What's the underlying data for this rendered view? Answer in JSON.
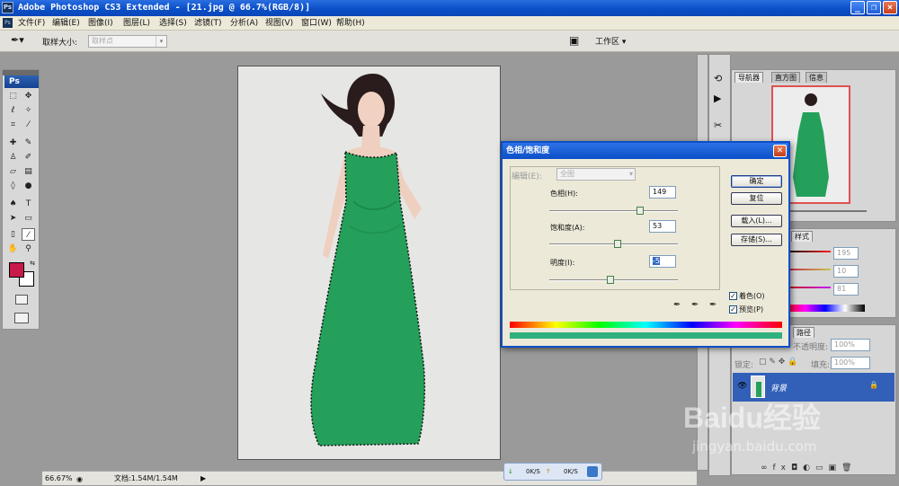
{
  "window": {
    "title": "Adobe Photoshop CS3 Extended - [21.jpg @ 66.7%(RGB/8)]"
  },
  "menu": [
    "文件(F)",
    "编辑(E)",
    "图像(I)",
    "图层(L)",
    "选择(S)",
    "滤镜(T)",
    "分析(A)",
    "视图(V)",
    "窗口(W)",
    "帮助(H)"
  ],
  "options": {
    "sample_size_label": "取样大小:",
    "sample_value": "取样点",
    "workspace": "工作区 ▾"
  },
  "toolbox": {
    "badge": "Ps"
  },
  "status": {
    "zoom": "66.67%",
    "doc": "文档:1.54M/1.54M"
  },
  "network": {
    "down": "0K/S",
    "up": "0K/S"
  },
  "navigator": {
    "tabs": [
      "导航器",
      "直方图",
      "信息"
    ]
  },
  "color_panel": {
    "tab": "样式",
    "values": [
      "195",
      "10",
      "81"
    ]
  },
  "layers": {
    "tab": "路径",
    "opacity_label": "不透明度:",
    "opacity": "100%",
    "lock_label": "锁定:",
    "fill_label": "填充:",
    "fill": "100%",
    "layer_name": "背景"
  },
  "dialog": {
    "title": "色相/饱和度",
    "edit_label": "编辑(E):",
    "edit_value": "全图",
    "hue_label": "色相(H):",
    "hue": "149",
    "hue_frac": 0.707,
    "sat_label": "饱和度(A):",
    "sat": "53",
    "sat_frac": 0.53,
    "light_label": "明度(I):",
    "light": "-5",
    "light_frac": 0.475,
    "ok": "确定",
    "cancel": "复位",
    "load": "载入(L)...",
    "save": "存储(S)...",
    "colorize": "着色(O)",
    "preview": "预览(P)"
  },
  "watermark": {
    "logo": "Baidu经验",
    "url": "jingyan.baidu.com"
  },
  "colors": {
    "fg": "#c8184c",
    "dress": "#24a05a",
    "accent": "#0b4fc8"
  }
}
